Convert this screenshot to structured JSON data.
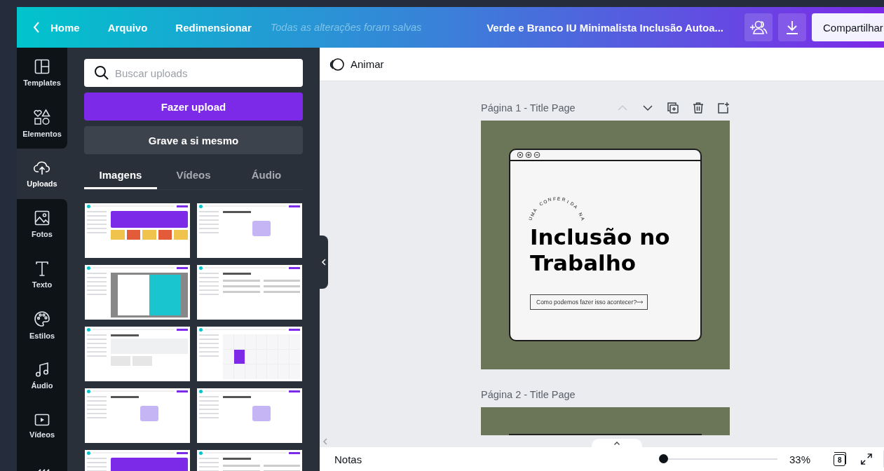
{
  "top_bar": {
    "back_label": "Home",
    "menu": [
      "Arquivo",
      "Redimensionar"
    ],
    "save_status": "Todas as alterações foram salvas",
    "design_title": "Verde e Branco IU Minimalista Inclusão Autoa...",
    "share_button": "Compartilhar"
  },
  "sidebar": {
    "items": [
      {
        "kind": "templates",
        "label": "Templates",
        "selected": false
      },
      {
        "kind": "elements",
        "label": "Elementos",
        "selected": false
      },
      {
        "kind": "uploads",
        "label": "Uploads",
        "selected": true
      },
      {
        "kind": "photos",
        "label": "Fotos",
        "selected": false
      },
      {
        "kind": "text",
        "label": "Texto",
        "selected": false
      },
      {
        "kind": "styles",
        "label": "Estilos",
        "selected": false
      },
      {
        "kind": "audio",
        "label": "Áudio",
        "selected": false
      },
      {
        "kind": "videos",
        "label": "Vídeos",
        "selected": false
      },
      {
        "kind": "background",
        "selected": false
      }
    ]
  },
  "upload_panel": {
    "search": {
      "placeholder": "Buscar uploads"
    },
    "upload_button": "Fazer upload",
    "record_button": "Grave a si mesmo",
    "tabs": [
      {
        "label": "Imagens",
        "selected": true
      },
      {
        "label": "Vídeos",
        "selected": false
      },
      {
        "label": "Áudio",
        "selected": false
      }
    ],
    "uploads": [
      {
        "kind": "banner"
      },
      {
        "kind": "illustration"
      },
      {
        "kind": "modal"
      },
      {
        "kind": "list"
      },
      {
        "kind": "brand"
      },
      {
        "kind": "calendar"
      },
      {
        "kind": "illustration"
      },
      {
        "kind": "illustration"
      },
      {
        "kind": "banner"
      },
      {
        "kind": "list"
      }
    ]
  },
  "toolbar": {
    "animate_button": "Animar"
  },
  "pages": [
    {
      "label": "Página 1 - Title Page",
      "selected": true,
      "design": {
        "arc_text": "UMA CONFERIDA NA",
        "heading": "Inclusão no Trabalho",
        "cta": "Como podemos fazer isso acontecer?"
      }
    },
    {
      "label": "Página 2 - Title Page",
      "selected": false
    }
  ],
  "bottom_bar": {
    "notes": "Notas",
    "zoom": {
      "level": 0,
      "reading": "33%"
    },
    "page_count": "8"
  }
}
